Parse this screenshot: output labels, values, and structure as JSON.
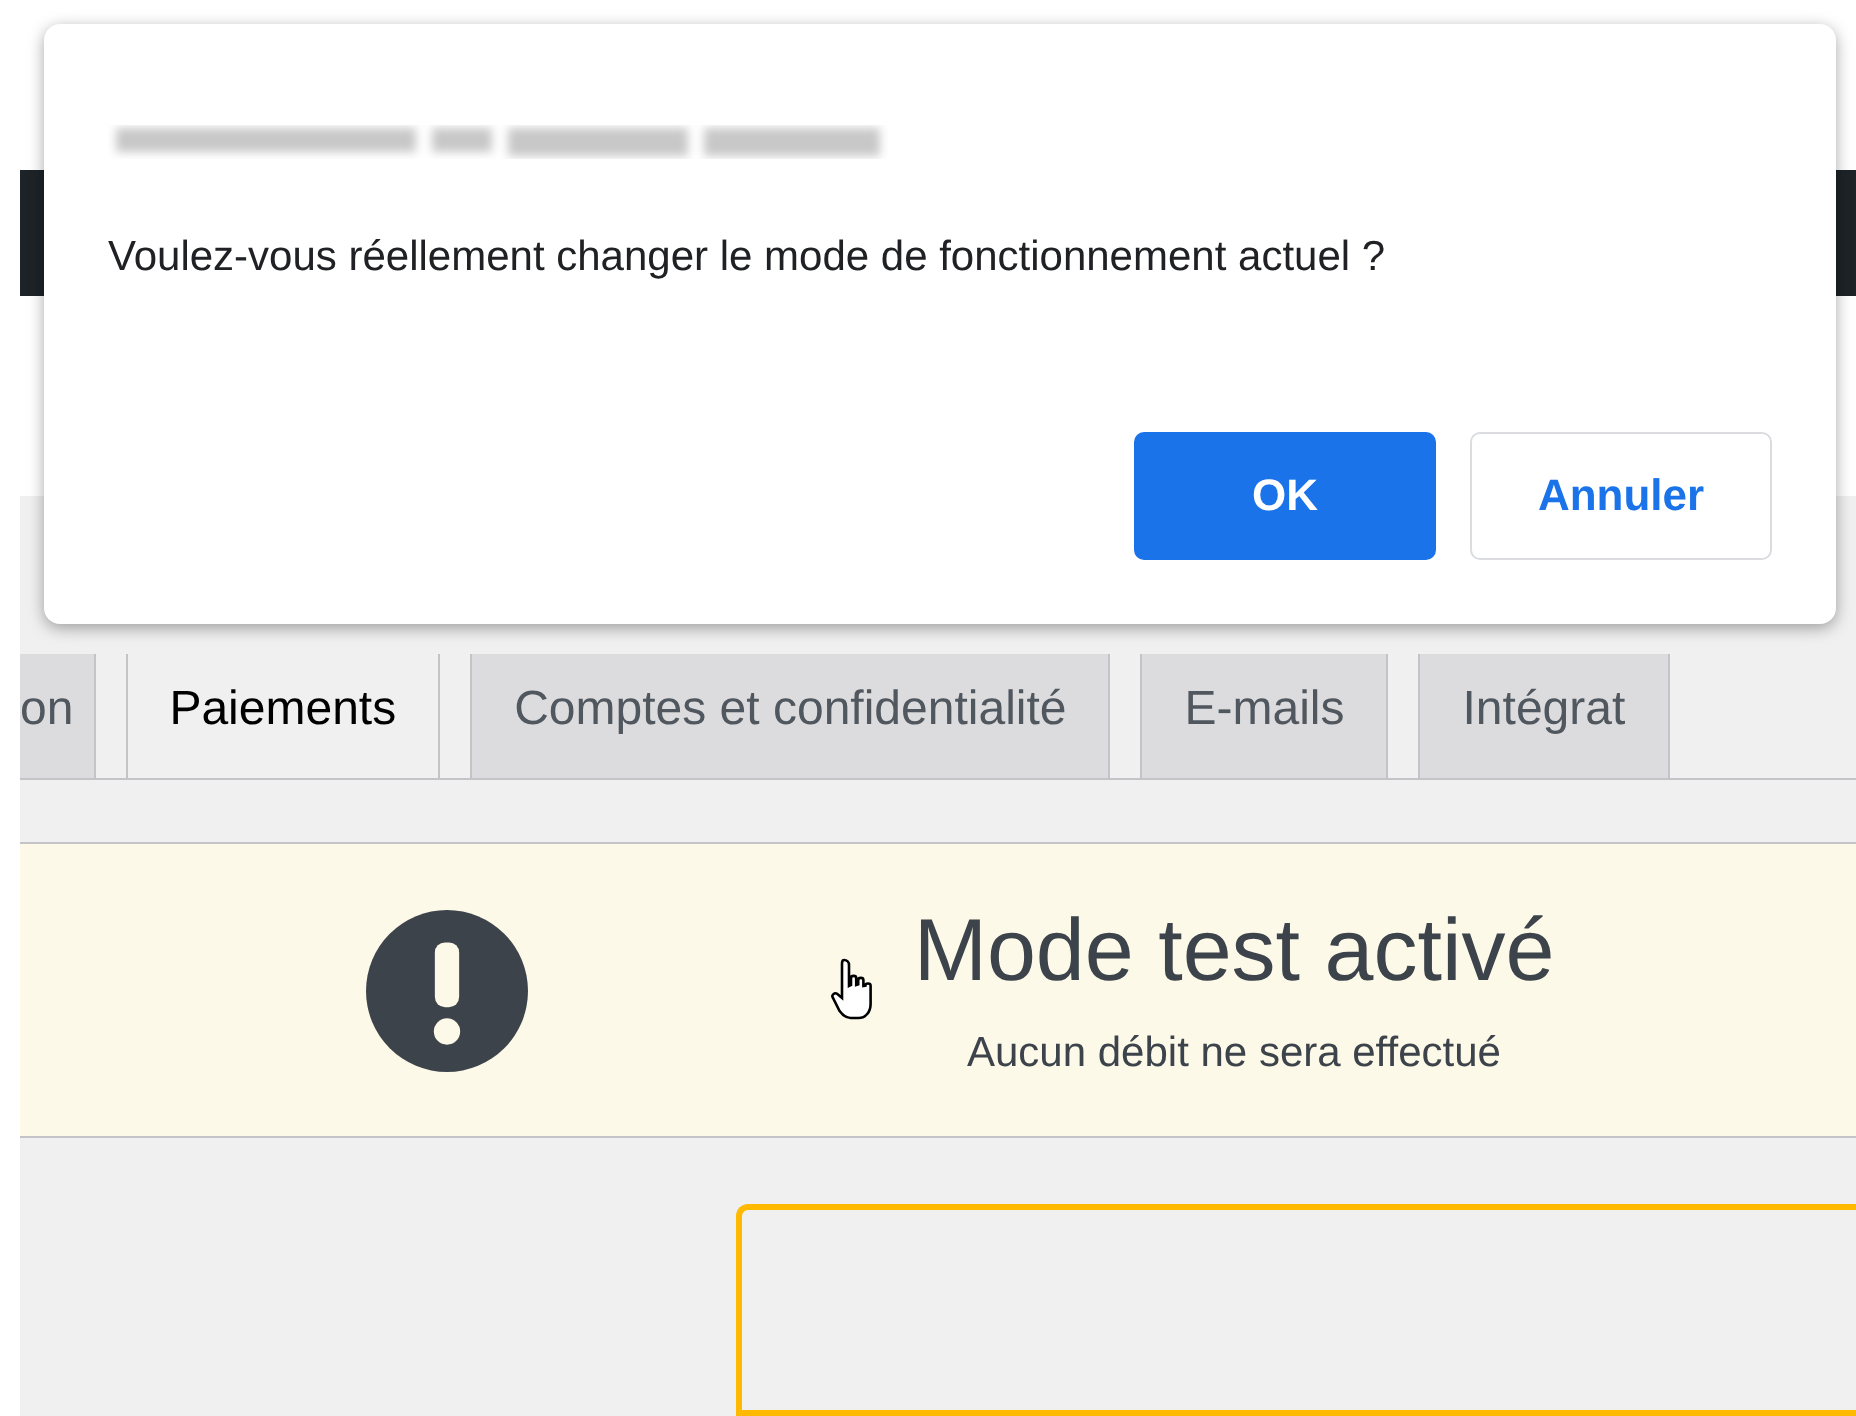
{
  "dialog": {
    "message": "Voulez-vous réellement changer le mode de fonctionnement actuel ?",
    "buttons": [
      {
        "label": "OK",
        "kind": "primary"
      },
      {
        "label": "Annuler",
        "kind": "secondary"
      }
    ]
  },
  "tabs": [
    {
      "label": "on",
      "selected": false
    },
    {
      "label": "Paiements",
      "selected": true
    },
    {
      "label": "Comptes et confidentialité",
      "selected": false
    },
    {
      "label": "E-mails",
      "selected": false
    },
    {
      "label": "Intégrat",
      "selected": false
    }
  ],
  "notice": {
    "title": "Mode test activé",
    "subtitle": "Aucun débit ne sera effectué"
  }
}
